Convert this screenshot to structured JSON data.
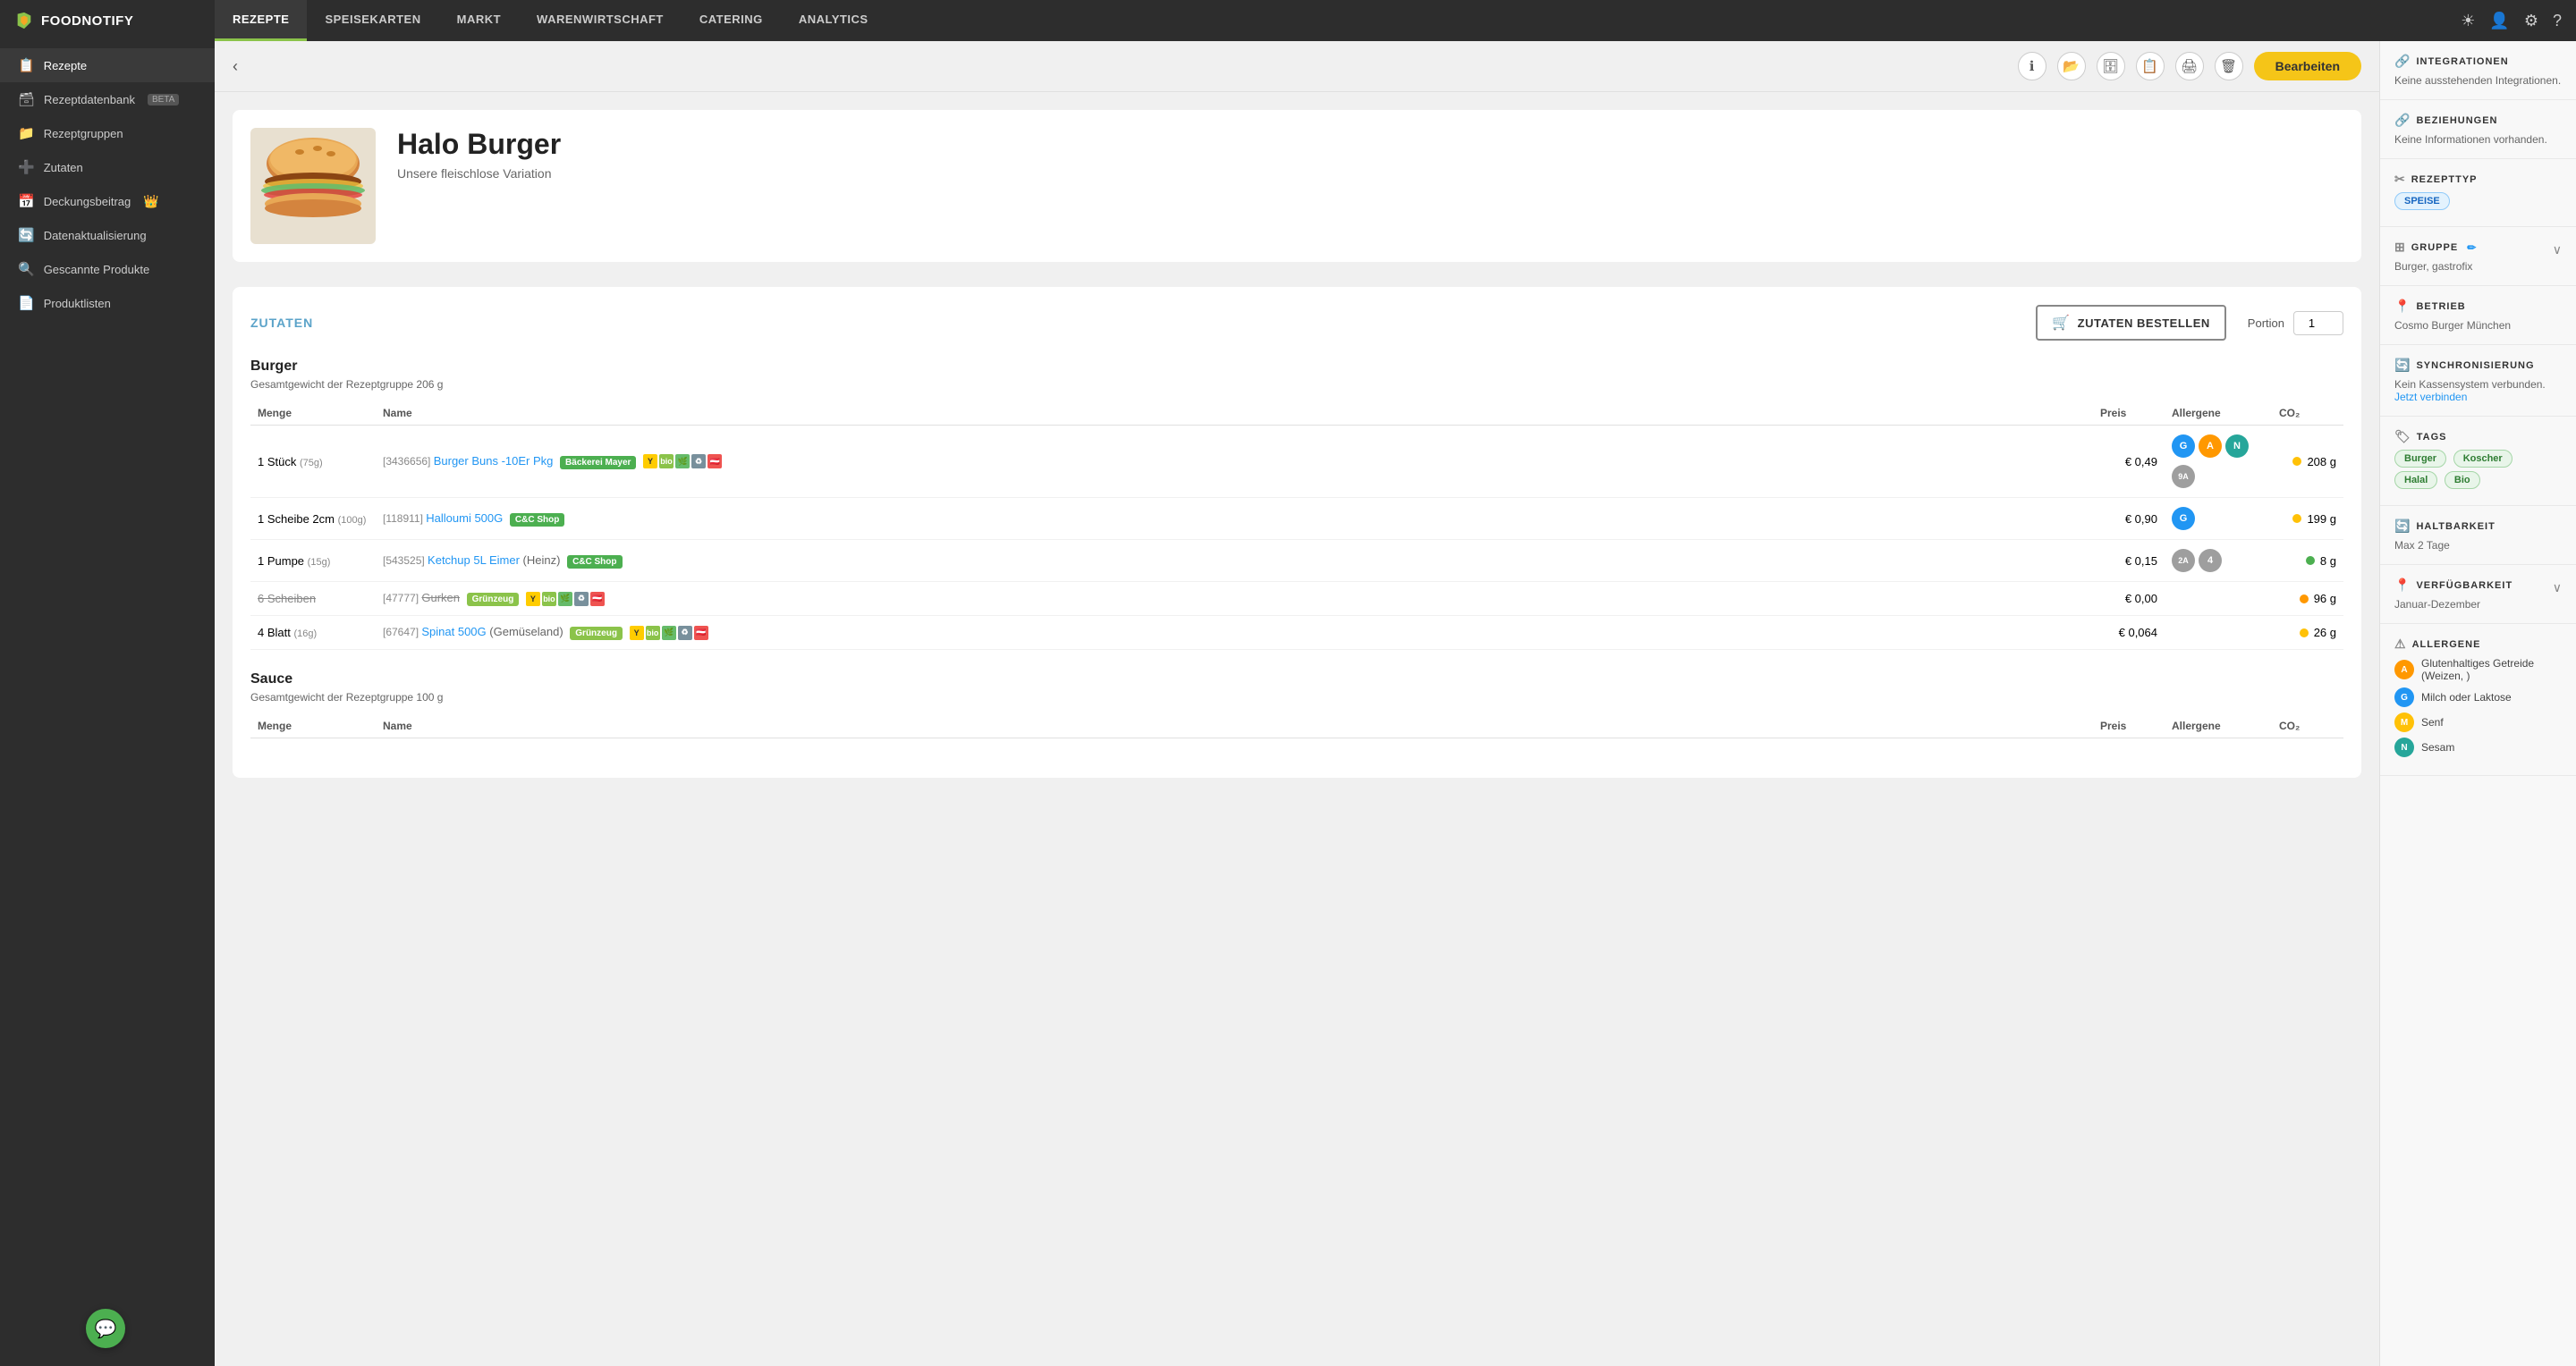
{
  "app": {
    "logo_text": "FOODNOTIFY",
    "logo_icon": "🔔"
  },
  "top_nav": {
    "tabs": [
      {
        "label": "REZEPTE",
        "active": true
      },
      {
        "label": "SPEISEKARTEN",
        "active": false
      },
      {
        "label": "MARKT",
        "active": false
      },
      {
        "label": "WARENWIRTSCHAFT",
        "active": false
      },
      {
        "label": "CATERING",
        "active": false
      },
      {
        "label": "ANALYTICS",
        "active": false
      }
    ],
    "icons": [
      "☀",
      "👤",
      "⚙",
      "?"
    ]
  },
  "sidebar": {
    "items": [
      {
        "label": "Rezepte",
        "icon": "📋",
        "active": true
      },
      {
        "label": "Rezeptdatenbank",
        "icon": "🗃",
        "badge": "BETA"
      },
      {
        "label": "Rezeptgruppen",
        "icon": "📁"
      },
      {
        "label": "Zutaten",
        "icon": "➕"
      },
      {
        "label": "Deckungsbeitrag",
        "icon": "📅",
        "crown": true
      },
      {
        "label": "Datenaktualisierung",
        "icon": "🔄"
      },
      {
        "label": "Gescannte Produkte",
        "icon": "🔍"
      },
      {
        "label": "Produktlisten",
        "icon": "📄"
      }
    ]
  },
  "toolbar": {
    "bearbeiten_label": "Bearbeiten"
  },
  "recipe": {
    "title": "Halo Burger",
    "subtitle": "Unsere fleischlose Variation",
    "ingredients_label": "ZUTATEN",
    "order_btn_label": "ZUTATEN BESTELLEN",
    "portion_label": "Portion",
    "portion_value": "1"
  },
  "groups": [
    {
      "name": "Burger",
      "weight": "Gesamtgewicht der Rezeptgruppe 206 g",
      "rows": [
        {
          "menge": "1 Stück",
          "menge_sub": "(75g)",
          "id": "3436656",
          "name": "Burger Buns -10Er Pkg",
          "supplier": "Bäckerei Mayer",
          "preis": "€ 0,49",
          "allergens": [
            {
              "letter": "G",
              "color": "blue"
            },
            {
              "letter": "A",
              "color": "yellow"
            },
            {
              "letter": "N",
              "color": "teal"
            },
            {
              "letter": "9A",
              "color": "gray",
              "small": true
            }
          ],
          "co2": "208 g",
          "co2_color": "yellow",
          "has_y": true,
          "has_bio": true,
          "has_leaf": true,
          "has_recycle": true,
          "has_at": true
        },
        {
          "menge": "1 Scheibe 2cm",
          "menge_sub": "(100g)",
          "id": "118911",
          "name": "Halloumi 500G",
          "supplier": "C&C Shop",
          "preis": "€ 0,90",
          "allergens": [
            {
              "letter": "G",
              "color": "blue"
            }
          ],
          "co2": "199 g",
          "co2_color": "yellow"
        },
        {
          "menge": "1 Pumpe",
          "menge_sub": "(15g)",
          "id": "543525",
          "name": "Ketchup 5L Eimer",
          "name_extra": "(Heinz)",
          "supplier": "C&C Shop",
          "preis": "€ 0,15",
          "allergens": [
            {
              "letter": "2A",
              "color": "gray"
            },
            {
              "letter": "4",
              "color": "gray"
            }
          ],
          "co2": "8 g",
          "co2_color": "green"
        },
        {
          "menge": "6 Scheiben",
          "menge_sub": "",
          "id": "47777",
          "name": "Gurken",
          "supplier": "Grünzeug",
          "preis": "€ 0,00",
          "allergens": [],
          "co2": "96 g",
          "co2_color": "orange",
          "has_y": true,
          "has_bio": true,
          "has_leaf": true,
          "has_recycle": true,
          "has_at": true,
          "strikethrough": true
        },
        {
          "menge": "4 Blatt",
          "menge_sub": "(16g)",
          "id": "67647",
          "name": "Spinat 500G",
          "name_extra": "(Gemüseland)",
          "supplier": "Grünzeug",
          "preis": "€ 0,064",
          "allergens": [],
          "co2": "26 g",
          "co2_color": "yellow",
          "has_y": true,
          "has_bio": true,
          "has_leaf": true,
          "has_recycle": true,
          "has_at": true
        }
      ]
    },
    {
      "name": "Sauce",
      "weight": "Gesamtgewicht der Rezeptgruppe 100 g",
      "rows": []
    }
  ],
  "right_panel": {
    "sections": {
      "integrationen": {
        "title": "INTEGRATIONEN",
        "value": "Keine ausstehenden Integrationen."
      },
      "beziehungen": {
        "title": "BEZIEHUNGEN",
        "value": "Keine Informationen vorhanden."
      },
      "rezepttyp": {
        "title": "REZEPTTYP",
        "tag": "SPEISE"
      },
      "gruppe": {
        "title": "GRUPPE",
        "value": "Burger, gastrofix"
      },
      "betrieb": {
        "title": "BETRIEB",
        "value": "Cosmo Burger München"
      },
      "synchronisierung": {
        "title": "SYNCHRONISIERUNG",
        "value": "Kein Kassensystem verbunden.",
        "link": "Jetzt verbinden"
      },
      "tags": {
        "title": "TAGS",
        "items": [
          "Burger",
          "Koscher",
          "Halal",
          "Bio"
        ]
      },
      "haltbarkeit": {
        "title": "HALTBARKEIT",
        "value": "Max 2 Tage"
      },
      "verfügbarkeit": {
        "title": "VERFÜGBARKEIT",
        "value": "Januar-Dezember"
      },
      "allergene": {
        "title": "ALLERGENE",
        "items": [
          {
            "letter": "A",
            "color": "#ff9800",
            "label": "Glutenhaltiges Getreide (Weizen, )"
          },
          {
            "letter": "G",
            "color": "#2196f3",
            "label": "Milch oder Laktose"
          },
          {
            "letter": "M",
            "color": "#ffc107",
            "label": "Senf"
          },
          {
            "letter": "N",
            "color": "#26a69a",
            "label": "Sesam"
          }
        ]
      }
    }
  }
}
